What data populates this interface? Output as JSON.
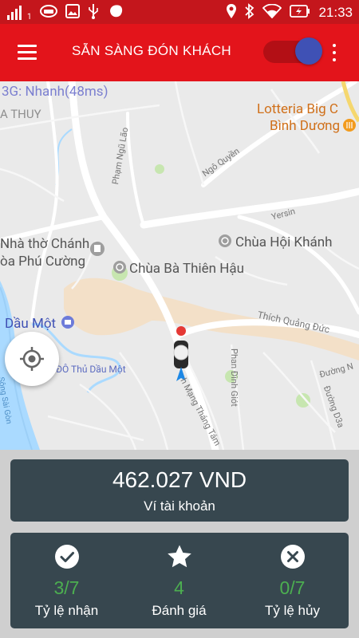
{
  "status_bar": {
    "time": "21:33",
    "sim_label": "1",
    "icons": [
      "signal-icon",
      "car-notification-icon",
      "image-notification-icon",
      "usb-icon",
      "app-notification-icon",
      "location-icon",
      "bluetooth-icon",
      "wifi-icon",
      "battery-charging-icon"
    ]
  },
  "app_bar": {
    "title": "SẴN SÀNG ĐÓN KHÁCH",
    "toggle_on": true
  },
  "map": {
    "network_status": "3G: Nhanh(48ms)",
    "labels": {
      "a_thuy": "A THUY",
      "lotteria_1": "Lotteria Big C",
      "lotteria_2": "Bình Dương",
      "pham_ngu_lao": "Phạm Ngũ Lão",
      "ngo_quyen": "Ngô Quyền",
      "yersin": "Yersin",
      "nha_tho_1": "Nhà thờ Chánh",
      "nha_tho_2": "òa Phú Cường",
      "chua_hoi_khanh": "Chùa Hội Khánh",
      "chua_ba": "Chùa Bà Thiên Hậu",
      "dau_mot": "Dầu Một",
      "thich_quang_duc": "Thích Quảng Đức",
      "do_thu_dau_mot": "ĐÔ Thủ Dầu Một",
      "phan_dinh_giot": "Phan Đình Giót",
      "duong_n": "Đường N",
      "cach_mang_thang_tam": "h Mạng Tháng Tám",
      "duong_d3a": "Đường D3a",
      "song_sai_gon": "Sông Sài Gòn"
    }
  },
  "wallet": {
    "amount": "462.027 VND",
    "label": "Ví tài khoản"
  },
  "stats": [
    {
      "value": "3/7",
      "label": "Tỷ lệ nhận",
      "icon": "check-circle-icon"
    },
    {
      "value": "4",
      "label": "Đánh giá",
      "icon": "star-icon"
    },
    {
      "value": "0/7",
      "label": "Tỷ lệ hủy",
      "icon": "cancel-circle-icon"
    }
  ],
  "colors": {
    "status_bar": "#c4161c",
    "app_bar": "#e3141b",
    "toggle_thumb": "#3f51b5",
    "card": "#37474f",
    "stat_value": "#4caf50",
    "panel": "#cfcfcf"
  }
}
